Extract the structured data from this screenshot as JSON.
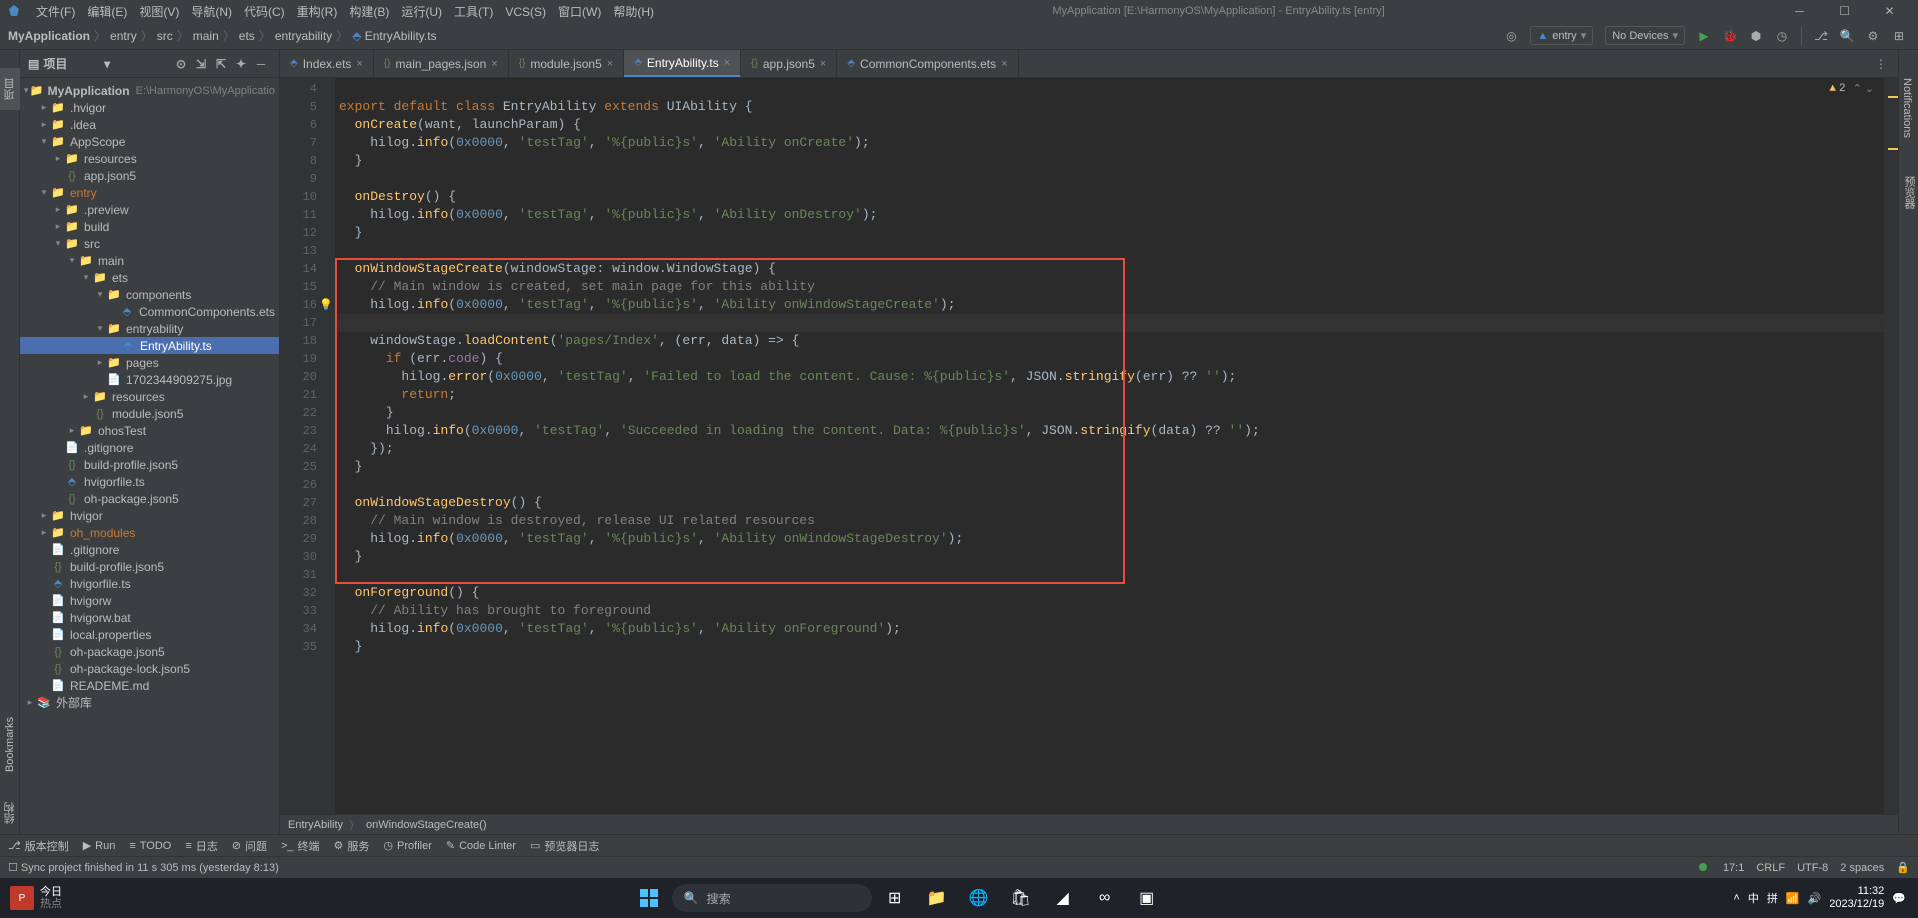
{
  "window": {
    "app_title": "MyApplication [E:\\HarmonyOS\\MyApplication] - EntryAbility.ts [entry]"
  },
  "menu": [
    "文件(F)",
    "编辑(E)",
    "视图(V)",
    "导航(N)",
    "代码(C)",
    "重构(R)",
    "构建(B)",
    "运行(U)",
    "工具(T)",
    "VCS(S)",
    "窗口(W)",
    "帮助(H)"
  ],
  "breadcrumbs": [
    "MyApplication",
    "entry",
    "src",
    "main",
    "ets",
    "entryability",
    "EntryAbility.ts"
  ],
  "run_config": "entry",
  "device_select": "No Devices",
  "project": {
    "panel_title": "项目",
    "root_label": "MyApplication",
    "root_desc": "E:\\HarmonyOS\\MyApplicatio",
    "items": [
      {
        "pad": 1,
        "arrow": ">",
        "type": "folder",
        "label": ".hvigor"
      },
      {
        "pad": 1,
        "arrow": ">",
        "type": "folder",
        "label": ".idea"
      },
      {
        "pad": 1,
        "arrow": "v",
        "type": "folder",
        "label": "AppScope"
      },
      {
        "pad": 2,
        "arrow": ">",
        "type": "folder",
        "label": "resources"
      },
      {
        "pad": 2,
        "arrow": "",
        "type": "file-json",
        "label": "app.json5"
      },
      {
        "pad": 1,
        "arrow": "v",
        "type": "folder-orange",
        "label": "entry",
        "orange": true
      },
      {
        "pad": 2,
        "arrow": ">",
        "type": "folder-orange",
        "label": ".preview"
      },
      {
        "pad": 2,
        "arrow": ">",
        "type": "folder-orange",
        "label": "build"
      },
      {
        "pad": 2,
        "arrow": "v",
        "type": "folder-blue",
        "label": "src"
      },
      {
        "pad": 3,
        "arrow": "v",
        "type": "folder",
        "label": "main"
      },
      {
        "pad": 4,
        "arrow": "v",
        "type": "folder",
        "label": "ets"
      },
      {
        "pad": 5,
        "arrow": "v",
        "type": "folder",
        "label": "components"
      },
      {
        "pad": 6,
        "arrow": "",
        "type": "file-ts",
        "label": "CommonComponents.ets"
      },
      {
        "pad": 5,
        "arrow": "v",
        "type": "folder",
        "label": "entryability"
      },
      {
        "pad": 6,
        "arrow": "",
        "type": "file-ts",
        "label": "EntryAbility.ts",
        "selected": true
      },
      {
        "pad": 5,
        "arrow": ">",
        "type": "folder",
        "label": "pages"
      },
      {
        "pad": 5,
        "arrow": "",
        "type": "file",
        "label": "1702344909275.jpg"
      },
      {
        "pad": 4,
        "arrow": ">",
        "type": "folder",
        "label": "resources"
      },
      {
        "pad": 4,
        "arrow": "",
        "type": "file-json",
        "label": "module.json5"
      },
      {
        "pad": 3,
        "arrow": ">",
        "type": "folder",
        "label": "ohosTest"
      },
      {
        "pad": 2,
        "arrow": "",
        "type": "file",
        "label": ".gitignore"
      },
      {
        "pad": 2,
        "arrow": "",
        "type": "file-json",
        "label": "build-profile.json5"
      },
      {
        "pad": 2,
        "arrow": "",
        "type": "file-ts",
        "label": "hvigorfile.ts"
      },
      {
        "pad": 2,
        "arrow": "",
        "type": "file-json",
        "label": "oh-package.json5"
      },
      {
        "pad": 1,
        "arrow": ">",
        "type": "folder",
        "label": "hvigor"
      },
      {
        "pad": 1,
        "arrow": ">",
        "type": "folder-orange",
        "label": "oh_modules",
        "orange": true
      },
      {
        "pad": 1,
        "arrow": "",
        "type": "file",
        "label": ".gitignore"
      },
      {
        "pad": 1,
        "arrow": "",
        "type": "file-json",
        "label": "build-profile.json5"
      },
      {
        "pad": 1,
        "arrow": "",
        "type": "file-ts",
        "label": "hvigorfile.ts"
      },
      {
        "pad": 1,
        "arrow": "",
        "type": "file",
        "label": "hvigorw"
      },
      {
        "pad": 1,
        "arrow": "",
        "type": "file",
        "label": "hvigorw.bat"
      },
      {
        "pad": 1,
        "arrow": "",
        "type": "file",
        "label": "local.properties"
      },
      {
        "pad": 1,
        "arrow": "",
        "type": "file-json",
        "label": "oh-package.json5"
      },
      {
        "pad": 1,
        "arrow": "",
        "type": "file-json",
        "label": "oh-package-lock.json5"
      },
      {
        "pad": 1,
        "arrow": "",
        "type": "file",
        "label": "READEME.md"
      }
    ],
    "ext_lib": "外部库"
  },
  "tabs": [
    {
      "icon": "ts",
      "name": "Index.ets"
    },
    {
      "icon": "json",
      "name": "main_pages.json"
    },
    {
      "icon": "json",
      "name": "module.json5"
    },
    {
      "icon": "ts",
      "name": "EntryAbility.ts",
      "active": true
    },
    {
      "icon": "json",
      "name": "app.json5"
    },
    {
      "icon": "ts",
      "name": "CommonComponents.ets"
    }
  ],
  "warnings": {
    "count": "2"
  },
  "editor_crumb": [
    "EntryAbility",
    "onWindowStageCreate()"
  ],
  "code_lines": [
    {
      "n": 4,
      "html": ""
    },
    {
      "n": 5,
      "html": "<span class='c-keyword'>export default class</span> <span class='c-type'>EntryAbility</span> <span class='c-keyword'>extends</span> <span class='c-type'>UIAbility</span> <span class='c-punct'>{</span>"
    },
    {
      "n": 6,
      "html": "  <span class='c-method'>onCreate</span><span class='c-punct'>(</span><span class='c-plain'>want</span><span class='c-punct'>,</span> <span class='c-plain'>launchParam</span><span class='c-punct'>) {</span>"
    },
    {
      "n": 7,
      "html": "    <span class='c-plain'>hilog</span><span class='c-punct'>.</span><span class='c-method'>info</span><span class='c-punct'>(</span><span class='c-num'>0x0000</span><span class='c-punct'>,</span> <span class='c-string'>'testTag'</span><span class='c-punct'>,</span> <span class='c-string'>'%{public}s'</span><span class='c-punct'>,</span> <span class='c-string'>'Ability onCreate'</span><span class='c-punct'>);</span>"
    },
    {
      "n": 8,
      "html": "  <span class='c-punct'>}</span>"
    },
    {
      "n": 9,
      "html": ""
    },
    {
      "n": 10,
      "html": "  <span class='c-method'>onDestroy</span><span class='c-punct'>() {</span>"
    },
    {
      "n": 11,
      "html": "    <span class='c-plain'>hilog</span><span class='c-punct'>.</span><span class='c-method'>info</span><span class='c-punct'>(</span><span class='c-num'>0x0000</span><span class='c-punct'>,</span> <span class='c-string'>'testTag'</span><span class='c-punct'>,</span> <span class='c-string'>'%{public}s'</span><span class='c-punct'>,</span> <span class='c-string'>'Ability onDestroy'</span><span class='c-punct'>);</span>"
    },
    {
      "n": 12,
      "html": "  <span class='c-punct'>}</span>"
    },
    {
      "n": 13,
      "html": ""
    },
    {
      "n": 14,
      "html": "  <span class='c-method'>onWindowStageCreate</span><span class='c-punct'>(</span><span class='c-plain'>windowStage</span><span class='c-punct'>:</span> <span class='c-plain'>window</span><span class='c-punct'>.</span><span class='c-type'>WindowStage</span><span class='c-punct'>) {</span>"
    },
    {
      "n": 15,
      "html": "    <span class='c-comment'>// Main window is created, set main page for this ability</span>"
    },
    {
      "n": 16,
      "bulb": true,
      "html": "    <span class='c-plain'>hilog</span><span class='c-punct'>.</span><span class='c-method'>info</span><span class='c-punct'>(</span><span class='c-num'>0x0000</span><span class='c-punct'>,</span> <span class='c-string'>'testTag'</span><span class='c-punct'>,</span> <span class='c-string'>'%{public}s'</span><span class='c-punct'>,</span> <span class='c-string'>'Ability onWindowStageCreate'</span><span class='c-punct'>);</span>"
    },
    {
      "n": 17,
      "caret": true,
      "html": ""
    },
    {
      "n": 18,
      "html": "    <span class='c-plain'>windowStage</span><span class='c-punct'>.</span><span class='c-method'>loadContent</span><span class='c-punct'>(</span><span class='c-string'>'pages/Index'</span><span class='c-punct'>, (</span><span class='c-plain'>err</span><span class='c-punct'>,</span> <span class='c-plain'>data</span><span class='c-punct'>) =&gt; {</span>"
    },
    {
      "n": 19,
      "html": "      <span class='c-keyword'>if</span> <span class='c-punct'>(</span><span class='c-plain'>err</span><span class='c-punct'>.</span><span class='c-prop'>code</span><span class='c-punct'>) {</span>"
    },
    {
      "n": 20,
      "html": "        <span class='c-plain'>hilog</span><span class='c-punct'>.</span><span class='c-method'>error</span><span class='c-punct'>(</span><span class='c-num'>0x0000</span><span class='c-punct'>,</span> <span class='c-string'>'testTag'</span><span class='c-punct'>,</span> <span class='c-string'>'Failed to load the content. Cause: %{public}s'</span><span class='c-punct'>,</span> <span class='c-global'>JSON</span><span class='c-punct'>.</span><span class='c-method'>stringify</span><span class='c-punct'>(</span><span class='c-plain'>err</span><span class='c-punct'>) ?? </span><span class='c-string'>''</span><span class='c-punct'>);</span>"
    },
    {
      "n": 21,
      "html": "        <span class='c-keyword'>return</span><span class='c-punct'>;</span>"
    },
    {
      "n": 22,
      "html": "      <span class='c-punct'>}</span>"
    },
    {
      "n": 23,
      "html": "      <span class='c-plain'>hilog</span><span class='c-punct'>.</span><span class='c-method'>info</span><span class='c-punct'>(</span><span class='c-num'>0x0000</span><span class='c-punct'>,</span> <span class='c-string'>'testTag'</span><span class='c-punct'>,</span> <span class='c-string'>'Succeeded in loading the content. Data: %{public}s'</span><span class='c-punct'>,</span> <span class='c-global'>JSON</span><span class='c-punct'>.</span><span class='c-method'>stringify</span><span class='c-punct'>(</span><span class='c-plain'>data</span><span class='c-punct'>) ?? </span><span class='c-string'>''</span><span class='c-punct'>);</span>"
    },
    {
      "n": 24,
      "html": "    <span class='c-punct'>});</span>"
    },
    {
      "n": 25,
      "html": "  <span class='c-punct'>}</span>"
    },
    {
      "n": 26,
      "html": ""
    },
    {
      "n": 27,
      "html": "  <span class='c-method'>onWindowStageDestroy</span><span class='c-punct'>() {</span>"
    },
    {
      "n": 28,
      "html": "    <span class='c-comment'>// Main window is destroyed, release UI related resources</span>"
    },
    {
      "n": 29,
      "html": "    <span class='c-plain'>hilog</span><span class='c-punct'>.</span><span class='c-method'>info</span><span class='c-punct'>(</span><span class='c-num'>0x0000</span><span class='c-punct'>,</span> <span class='c-string'>'testTag'</span><span class='c-punct'>,</span> <span class='c-string'>'%{public}s'</span><span class='c-punct'>,</span> <span class='c-string'>'Ability onWindowStageDestroy'</span><span class='c-punct'>);</span>"
    },
    {
      "n": 30,
      "html": "  <span class='c-punct'>}</span>"
    },
    {
      "n": 31,
      "html": ""
    },
    {
      "n": 32,
      "html": "  <span class='c-method'>onForeground</span><span class='c-punct'>() {</span>"
    },
    {
      "n": 33,
      "html": "    <span class='c-comment'>// Ability has brought to foreground</span>"
    },
    {
      "n": 34,
      "html": "    <span class='c-plain'>hilog</span><span class='c-punct'>.</span><span class='c-method'>info</span><span class='c-punct'>(</span><span class='c-num'>0x0000</span><span class='c-punct'>,</span> <span class='c-string'>'testTag'</span><span class='c-punct'>,</span> <span class='c-string'>'%{public}s'</span><span class='c-punct'>,</span> <span class='c-string'>'Ability onForeground'</span><span class='c-punct'>);</span>"
    },
    {
      "n": 35,
      "html": "  <span class='c-punct'>}</span>"
    }
  ],
  "highlight_box": {
    "top_line": 14,
    "bottom_line": 31
  },
  "side_tabs": {
    "left_project": "项目",
    "left_bookmarks": "Bookmarks",
    "left_structure": "结构",
    "right_notifications": "Notifications",
    "right_preview": "预览器"
  },
  "bottom_tools": [
    {
      "icon": "⎇",
      "label": "版本控制"
    },
    {
      "icon": "▶",
      "label": "Run"
    },
    {
      "icon": "≡",
      "label": "TODO"
    },
    {
      "icon": "≡",
      "label": "日志"
    },
    {
      "icon": "⊘",
      "label": "问题"
    },
    {
      "icon": ">_",
      "label": "终端"
    },
    {
      "icon": "⚙",
      "label": "服务"
    },
    {
      "icon": "◷",
      "label": "Profiler"
    },
    {
      "icon": "✎",
      "label": "Code Linter"
    },
    {
      "icon": "▭",
      "label": "预览器日志"
    }
  ],
  "status": {
    "message": "Sync project finished in 11 s 305 ms (yesterday 8:13)",
    "cursor": "17:1",
    "line_ending": "CRLF",
    "encoding": "UTF-8",
    "indent": "2 spaces"
  },
  "taskbar": {
    "weather_label": "今日",
    "weather_sub": "热点",
    "search_placeholder": "搜索",
    "ime": "中",
    "ime2": "拼",
    "time": "11:32",
    "date": "2023/12/19"
  }
}
